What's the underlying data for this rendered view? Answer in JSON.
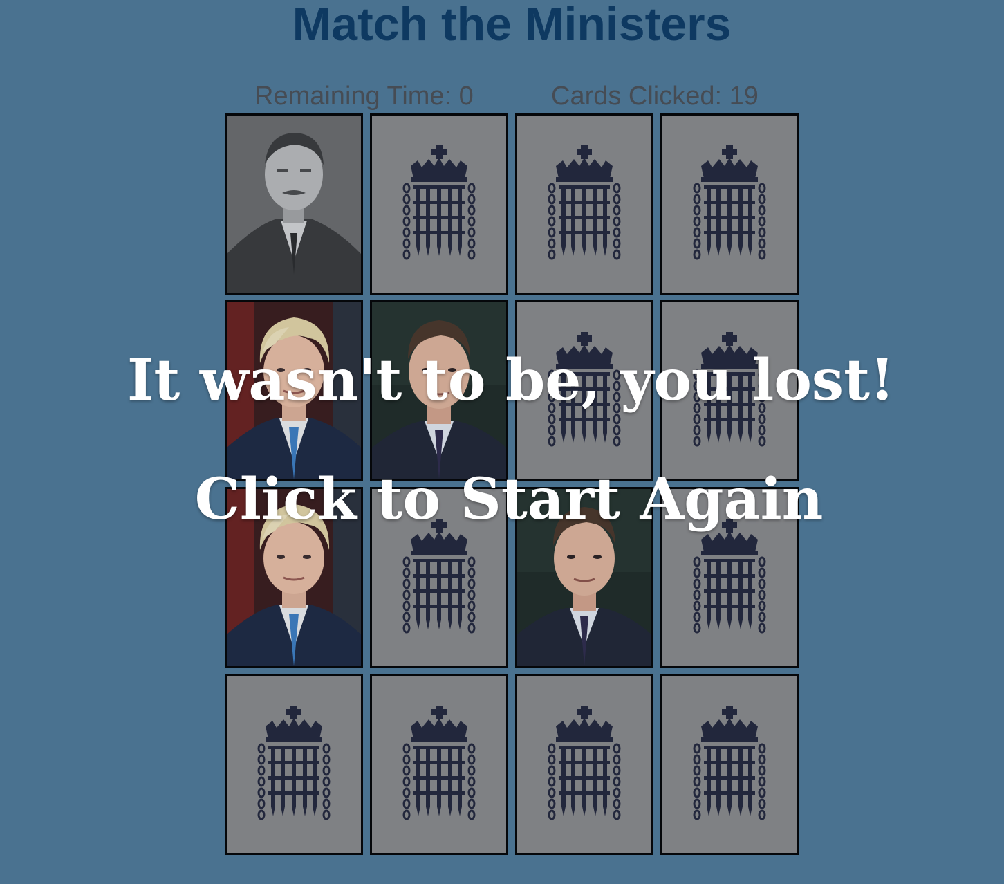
{
  "game": {
    "title": "Match the Ministers",
    "remaining_time_label": "Remaining Time: 0",
    "cards_clicked_label": "Cards Clicked: 19",
    "remaining_time": 0,
    "cards_clicked": 19
  },
  "overlay": {
    "message": "It wasn't to be, you lost!",
    "restart_label": "Click to Start Again"
  },
  "cards": [
    {
      "state": "face-up",
      "face": "portrait-bw-minister"
    },
    {
      "state": "face-down",
      "face": "portcullis-emblem"
    },
    {
      "state": "face-down",
      "face": "portcullis-emblem"
    },
    {
      "state": "face-down",
      "face": "portcullis-emblem"
    },
    {
      "state": "face-up",
      "face": "portrait-blonde-minister"
    },
    {
      "state": "face-up",
      "face": "portrait-darkhair-minister"
    },
    {
      "state": "face-down",
      "face": "portcullis-emblem"
    },
    {
      "state": "face-down",
      "face": "portcullis-emblem"
    },
    {
      "state": "face-up",
      "face": "portrait-blonde-minister"
    },
    {
      "state": "face-down",
      "face": "portcullis-emblem"
    },
    {
      "state": "face-up",
      "face": "portrait-darkhair-minister"
    },
    {
      "state": "face-down",
      "face": "portcullis-emblem"
    },
    {
      "state": "face-down",
      "face": "portcullis-emblem"
    },
    {
      "state": "face-down",
      "face": "portcullis-emblem"
    },
    {
      "state": "face-down",
      "face": "portcullis-emblem"
    },
    {
      "state": "face-down",
      "face": "portcullis-emblem"
    }
  ],
  "colors": {
    "background": "#4f7a99",
    "title": "#0b3a63",
    "card_back": "#8b8b8b",
    "emblem": "#22253a",
    "overlay_text": "#ffffff"
  }
}
